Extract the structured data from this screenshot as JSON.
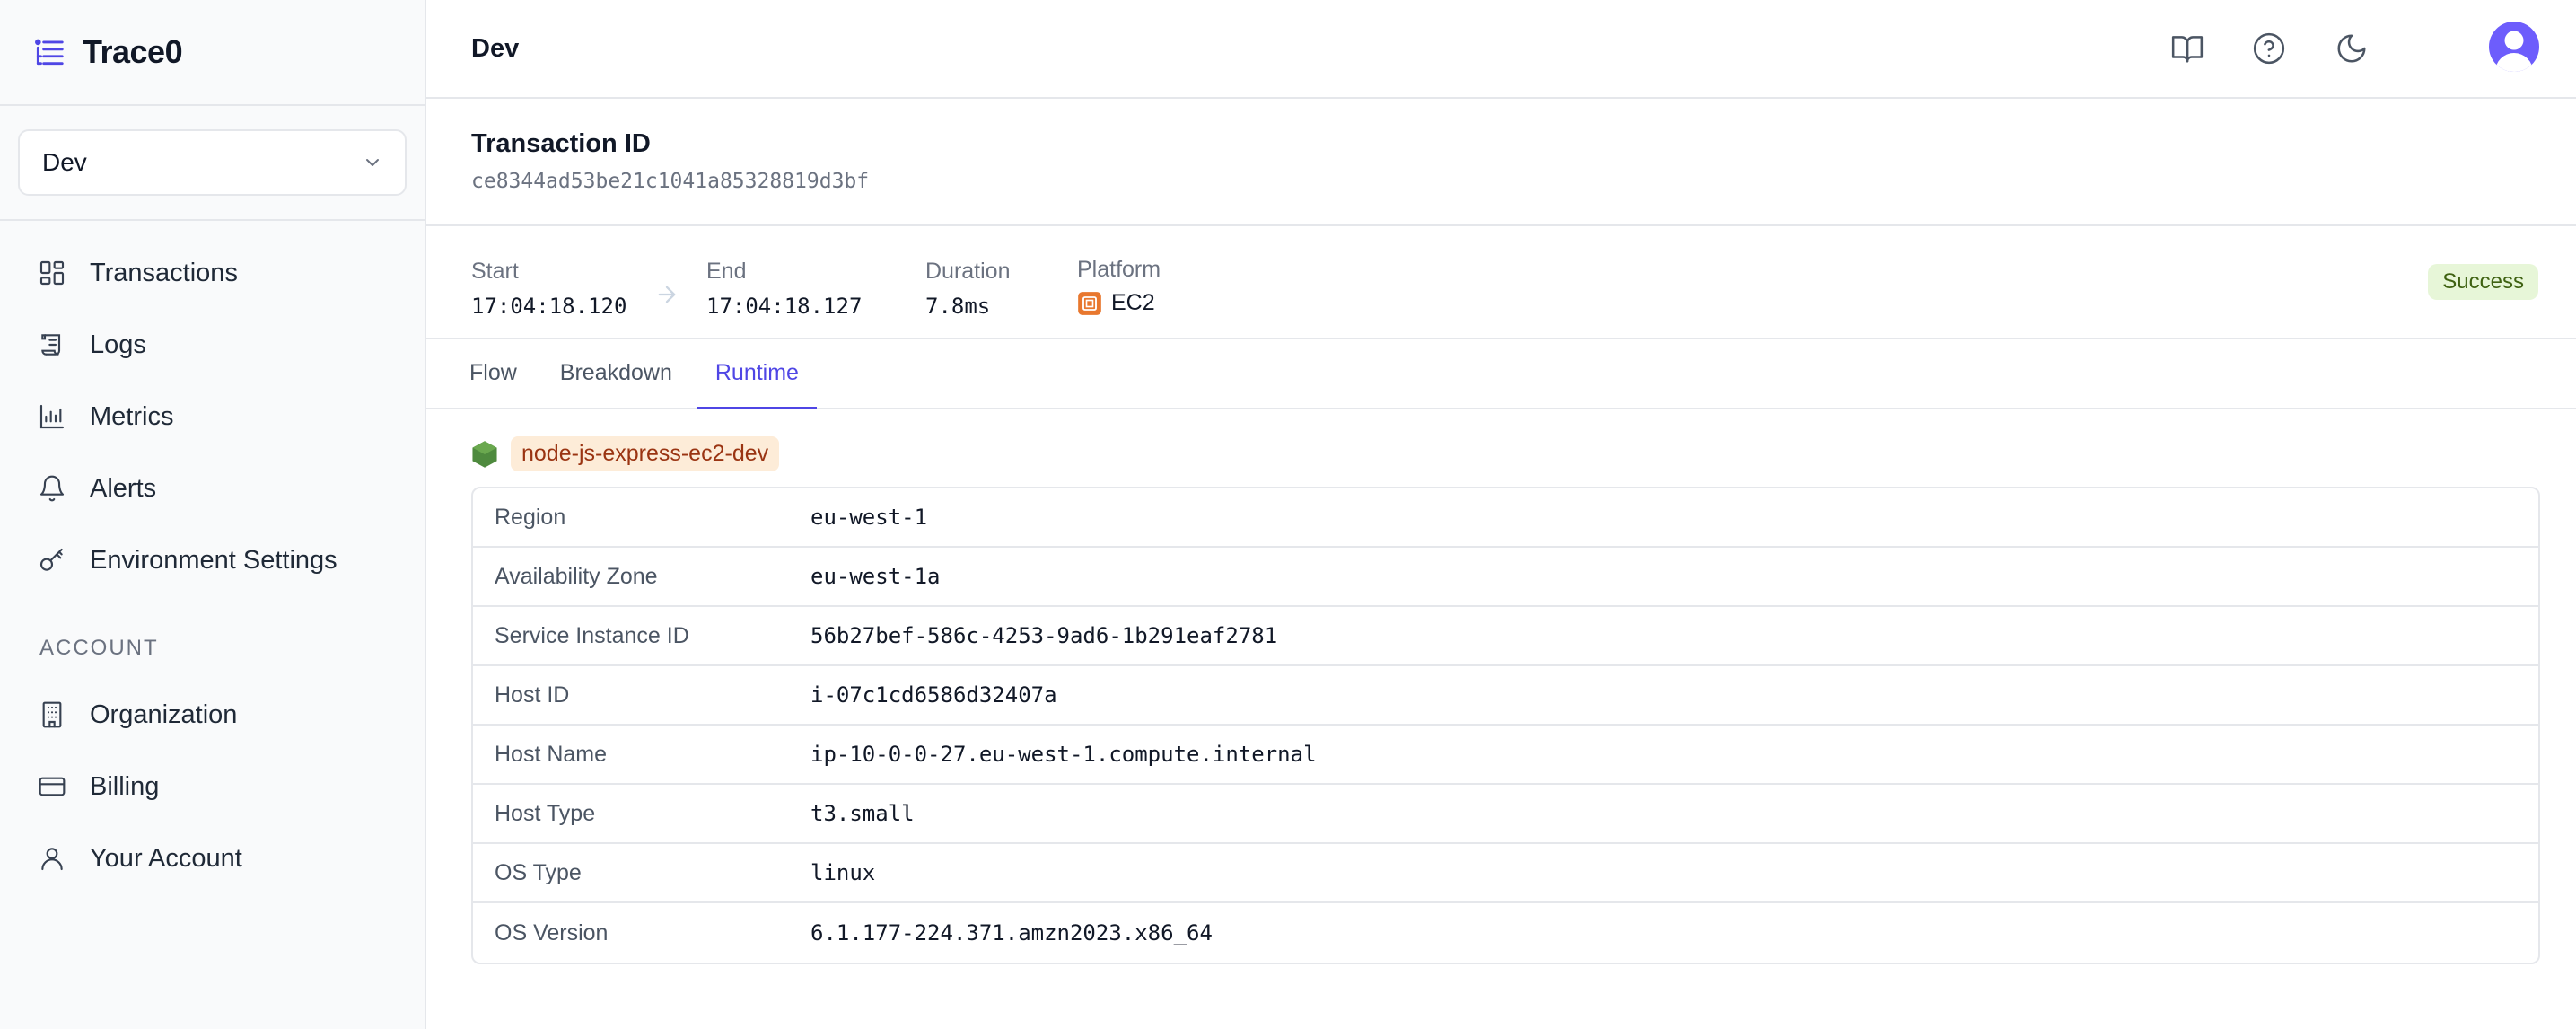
{
  "brand": {
    "name": "Trace0"
  },
  "sidebar": {
    "environment": "Dev",
    "nav": [
      {
        "label": "Transactions",
        "icon": "dashboard-icon"
      },
      {
        "label": "Logs",
        "icon": "scroll-icon"
      },
      {
        "label": "Metrics",
        "icon": "bar-chart-icon"
      },
      {
        "label": "Alerts",
        "icon": "bell-icon"
      },
      {
        "label": "Environment Settings",
        "icon": "key-icon"
      }
    ],
    "account_section": "ACCOUNT",
    "account": [
      {
        "label": "Organization",
        "icon": "building-icon"
      },
      {
        "label": "Billing",
        "icon": "credit-card-icon"
      },
      {
        "label": "Your Account",
        "icon": "user-icon"
      }
    ]
  },
  "header": {
    "breadcrumb": "Dev",
    "icons": [
      "book-icon",
      "help-icon",
      "moon-icon",
      "avatar"
    ]
  },
  "transaction": {
    "title": "Transaction ID",
    "id": "ce8344ad53be21c1041a85328819d3bf"
  },
  "meta": {
    "start_label": "Start",
    "start_value": "17:04:18.120",
    "end_label": "End",
    "end_value": "17:04:18.127",
    "duration_label": "Duration",
    "duration_value": "7.8ms",
    "platform_label": "Platform",
    "platform_value": "EC2",
    "status": "Success"
  },
  "tabs": [
    {
      "label": "Flow",
      "active": false
    },
    {
      "label": "Breakdown",
      "active": false
    },
    {
      "label": "Runtime",
      "active": true
    }
  ],
  "runtime": {
    "service_name": "node-js-express-ec2-dev",
    "rows": [
      {
        "key": "Region",
        "value": "eu-west-1"
      },
      {
        "key": "Availability Zone",
        "value": "eu-west-1a"
      },
      {
        "key": "Service Instance ID",
        "value": "56b27bef-586c-4253-9ad6-1b291eaf2781"
      },
      {
        "key": "Host ID",
        "value": "i-07c1cd6586d32407a"
      },
      {
        "key": "Host Name",
        "value": "ip-10-0-0-27.eu-west-1.compute.internal"
      },
      {
        "key": "Host Type",
        "value": "t3.small"
      },
      {
        "key": "OS Type",
        "value": "linux"
      },
      {
        "key": "OS Version",
        "value": "6.1.177-224.371.amzn2023.x86_64"
      }
    ]
  },
  "colors": {
    "accent": "#4f46e5",
    "success_bg": "#e7f6d8",
    "success_text": "#3f6212",
    "service_badge_bg": "#fdecd8",
    "service_badge_text": "#9a3412",
    "ec2_orange": "#e8772e",
    "node_green": "#4e8a3e"
  }
}
